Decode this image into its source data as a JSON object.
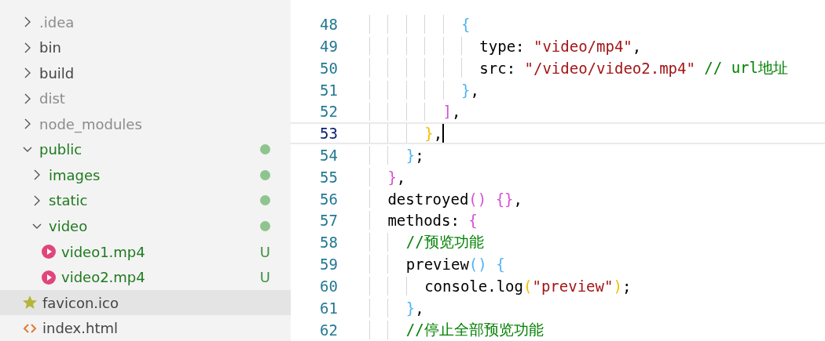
{
  "explorer": {
    "items": [
      {
        "name": ".idea",
        "kind": "folder",
        "expanded": false,
        "ignored": true,
        "untracked": false,
        "dot": false,
        "selected": false
      },
      {
        "name": "bin",
        "kind": "folder",
        "expanded": false,
        "ignored": false,
        "untracked": false,
        "dot": false,
        "selected": false
      },
      {
        "name": "build",
        "kind": "folder",
        "expanded": false,
        "ignored": false,
        "untracked": false,
        "dot": false,
        "selected": false
      },
      {
        "name": "dist",
        "kind": "folder",
        "expanded": false,
        "ignored": true,
        "untracked": false,
        "dot": false,
        "selected": false
      },
      {
        "name": "node_modules",
        "kind": "folder",
        "expanded": false,
        "ignored": true,
        "untracked": false,
        "dot": false,
        "selected": false
      },
      {
        "name": "public",
        "kind": "folder",
        "expanded": true,
        "ignored": false,
        "untracked": true,
        "dot": true,
        "selected": false,
        "children": [
          {
            "name": "images",
            "kind": "folder",
            "expanded": false,
            "ignored": false,
            "untracked": true,
            "dot": true,
            "selected": false
          },
          {
            "name": "static",
            "kind": "folder",
            "expanded": false,
            "ignored": false,
            "untracked": true,
            "dot": true,
            "selected": false
          },
          {
            "name": "video",
            "kind": "folder",
            "expanded": true,
            "ignored": false,
            "untracked": true,
            "dot": true,
            "selected": false,
            "children": [
              {
                "name": "video1.mp4",
                "kind": "video",
                "ignored": false,
                "untracked": true,
                "badge": "U",
                "selected": false
              },
              {
                "name": "video2.mp4",
                "kind": "video",
                "ignored": false,
                "untracked": true,
                "badge": "U",
                "selected": false
              }
            ]
          }
        ]
      },
      {
        "name": "favicon.ico",
        "kind": "star",
        "ignored": false,
        "untracked": false,
        "selected": true
      },
      {
        "name": "index.html",
        "kind": "html",
        "ignored": false,
        "untracked": false,
        "selected": false
      }
    ]
  },
  "editor": {
    "lines": [
      {
        "number": "48",
        "current": false,
        "tokens": [
          {
            "kind": "bracket",
            "text": "          {",
            "color": "#4fb3f0"
          }
        ]
      },
      {
        "number": "49",
        "current": false,
        "tokens": [
          {
            "kind": "text",
            "text": "            type: "
          },
          {
            "kind": "string",
            "text": "\"video/mp4\""
          },
          {
            "kind": "text",
            "text": ","
          }
        ]
      },
      {
        "number": "50",
        "current": false,
        "tokens": [
          {
            "kind": "text",
            "text": "            src: "
          },
          {
            "kind": "string",
            "text": "\"/video/video2.mp4\""
          },
          {
            "kind": "comment",
            "text": " // url地址"
          }
        ]
      },
      {
        "number": "51",
        "current": false,
        "tokens": [
          {
            "kind": "bracket",
            "text": "          }",
            "color": "#4fb3f0"
          },
          {
            "kind": "text",
            "text": ","
          }
        ]
      },
      {
        "number": "52",
        "current": false,
        "tokens": [
          {
            "kind": "bracket",
            "text": "        ]",
            "color": "#d84fd2"
          },
          {
            "kind": "text",
            "text": ","
          }
        ]
      },
      {
        "number": "53",
        "current": true,
        "tokens": [
          {
            "kind": "bracket",
            "text": "      }",
            "color": "#f0c000"
          },
          {
            "kind": "text",
            "text": ","
          }
        ]
      },
      {
        "number": "54",
        "current": false,
        "tokens": [
          {
            "kind": "bracket",
            "text": "    }",
            "color": "#4fb3f0"
          },
          {
            "kind": "text",
            "text": ";"
          }
        ]
      },
      {
        "number": "55",
        "current": false,
        "tokens": [
          {
            "kind": "bracket",
            "text": "  }",
            "color": "#d84fd2"
          },
          {
            "kind": "text",
            "text": ","
          }
        ]
      },
      {
        "number": "56",
        "current": false,
        "tokens": [
          {
            "kind": "text",
            "text": "  destroyed"
          },
          {
            "kind": "bracket",
            "text": "()",
            "color": "#d84fd2"
          },
          {
            "kind": "bracket",
            "text": " {}",
            "color": "#d84fd2"
          },
          {
            "kind": "text",
            "text": ","
          }
        ]
      },
      {
        "number": "57",
        "current": false,
        "tokens": [
          {
            "kind": "text",
            "text": "  methods: "
          },
          {
            "kind": "bracket",
            "text": "{",
            "color": "#d84fd2"
          }
        ]
      },
      {
        "number": "58",
        "current": false,
        "tokens": [
          {
            "kind": "comment",
            "text": "    //预览功能"
          }
        ]
      },
      {
        "number": "59",
        "current": false,
        "tokens": [
          {
            "kind": "text",
            "text": "    preview"
          },
          {
            "kind": "bracket",
            "text": "()",
            "color": "#4fb3f0"
          },
          {
            "kind": "bracket",
            "text": " {",
            "color": "#4fb3f0"
          }
        ]
      },
      {
        "number": "60",
        "current": false,
        "tokens": [
          {
            "kind": "text",
            "text": "      console.log"
          },
          {
            "kind": "bracket",
            "text": "(",
            "color": "#f0c000"
          },
          {
            "kind": "string",
            "text": "\"preview\""
          },
          {
            "kind": "bracket",
            "text": ")",
            "color": "#f0c000"
          },
          {
            "kind": "text",
            "text": ";"
          }
        ]
      },
      {
        "number": "61",
        "current": false,
        "tokens": [
          {
            "kind": "bracket",
            "text": "    }",
            "color": "#4fb3f0"
          },
          {
            "kind": "text",
            "text": ","
          }
        ]
      },
      {
        "number": "62",
        "current": false,
        "tokens": [
          {
            "kind": "comment",
            "text": "    //停止全部预览功能"
          }
        ]
      }
    ]
  }
}
